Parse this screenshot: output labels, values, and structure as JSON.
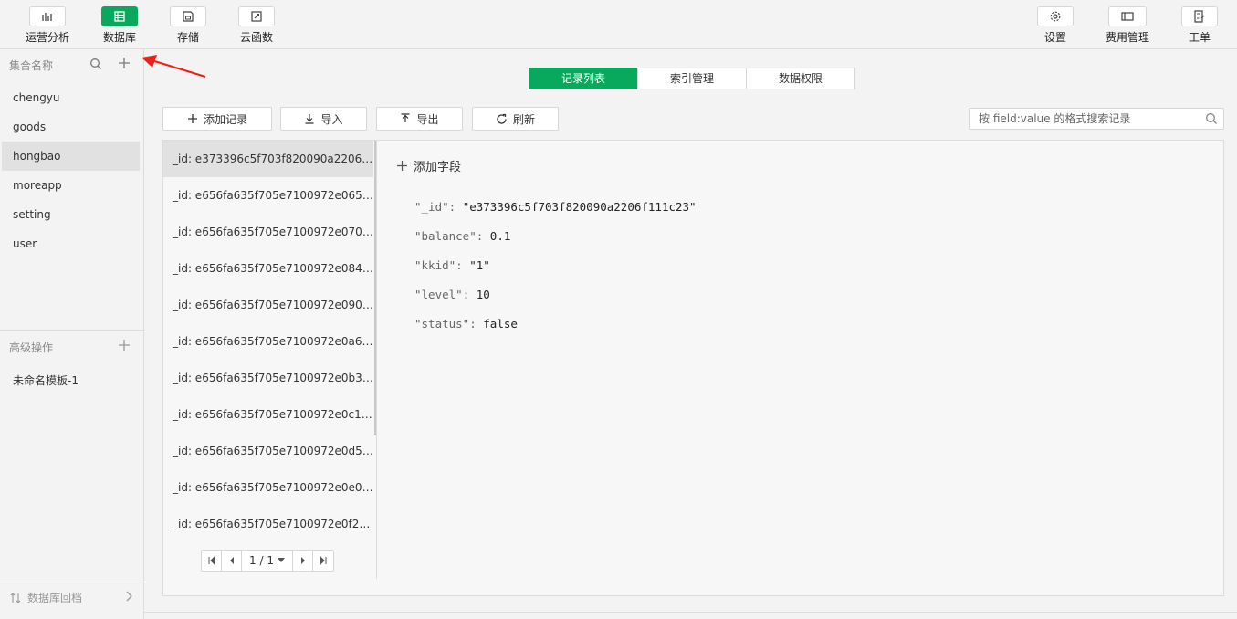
{
  "toolbar": {
    "left": [
      {
        "label": "运营分析",
        "icon": "bar-chart-icon"
      },
      {
        "label": "数据库",
        "icon": "database-icon",
        "active": true
      },
      {
        "label": "存储",
        "icon": "storage-icon"
      },
      {
        "label": "云函数",
        "icon": "function-icon"
      }
    ],
    "right": [
      {
        "label": "设置",
        "icon": "gear-icon"
      },
      {
        "label": "费用管理",
        "icon": "billing-icon"
      },
      {
        "label": "工单",
        "icon": "ticket-icon"
      }
    ]
  },
  "sidebar": {
    "collections_header": "集合名称",
    "collections": [
      "chengyu",
      "goods",
      "hongbao",
      "moreapp",
      "setting",
      "user"
    ],
    "active_collection": "hongbao",
    "advanced_header": "高级操作",
    "advanced_items": [
      "未命名模板-1"
    ],
    "footer": "数据库回档"
  },
  "tabs": [
    "记录列表",
    "索引管理",
    "数据权限"
  ],
  "active_tab": "记录列表",
  "actions": {
    "add": "添加记录",
    "import": "导入",
    "export": "导出",
    "refresh": "刷新"
  },
  "search": {
    "placeholder": "按 field:value 的格式搜索记录"
  },
  "records": [
    "_id: e373396c5f703f820090a2206f...",
    "_id: e656fa635f705e7100972e065c...",
    "_id: e656fa635f705e7100972e0703...",
    "_id: e656fa635f705e7100972e084e...",
    "_id: e656fa635f705e7100972e0907...",
    "_id: e656fa635f705e7100972e0a6f...",
    "_id: e656fa635f705e7100972e0b35...",
    "_id: e656fa635f705e7100972e0c1b...",
    "_id: e656fa635f705e7100972e0d5a...",
    "_id: e656fa635f705e7100972e0e04...",
    "_id: e656fa635f705e7100972e0f2b..."
  ],
  "pagination": {
    "label": "1 / 1"
  },
  "detail": {
    "add_field": "添加字段",
    "fields": [
      {
        "key": "\"_id\"",
        "value": "\"e373396c5f703f820090a2206f111c23\""
      },
      {
        "key": "\"balance\"",
        "value": "0.1"
      },
      {
        "key": "\"kkid\"",
        "value": "\"1\""
      },
      {
        "key": "\"level\"",
        "value": "10"
      },
      {
        "key": "\"status\"",
        "value": "false"
      }
    ]
  },
  "colors": {
    "accent": "#09a95d",
    "annotation_arrow": "#e8231b"
  }
}
